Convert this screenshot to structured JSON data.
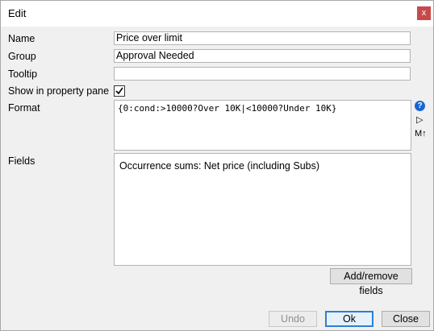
{
  "window": {
    "title": "Edit",
    "close_glyph": "x"
  },
  "labels": {
    "name": "Name",
    "group": "Group",
    "tooltip": "Tooltip",
    "show_in_pane": "Show in property pane",
    "format": "Format",
    "fields": "Fields"
  },
  "values": {
    "name": "Price over limit",
    "group": "Approval Needed",
    "tooltip": "",
    "show_in_pane": true,
    "format": "{0:cond:>10000?Over 10K|<10000?Under 10K}",
    "fields": "Occurrence sums: Net price (including Subs)"
  },
  "icons": {
    "help": "?",
    "play": "▷",
    "mt": "M↑"
  },
  "buttons": {
    "add_remove": "Add/remove fields",
    "undo": "Undo",
    "ok": "Ok",
    "close": "Close"
  }
}
